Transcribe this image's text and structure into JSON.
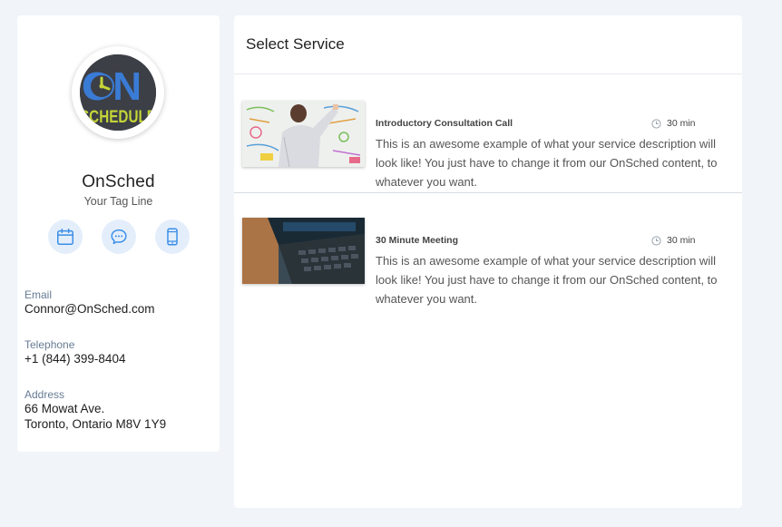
{
  "profile": {
    "logo": {
      "icon": "onschedule-clock-logo",
      "top_text": "ON",
      "bottom_text": "SCHEDULE",
      "top_color": "#3a7bd5",
      "bottom_color": "#c5d636",
      "bg_color": "#3c3f46"
    },
    "name": "OnSched",
    "tagline": "Your Tag Line",
    "contact_icons": [
      "calendar-icon",
      "chat-icon",
      "mobile-icon"
    ],
    "email_label": "Email",
    "email": "Connor@OnSched.com",
    "telephone_label": "Telephone",
    "telephone": "+1 (844) 399-8404",
    "address_label": "Address",
    "address_line1": "66 Mowat Ave.",
    "address_line2": "Toronto, Ontario M8V 1Y9"
  },
  "main": {
    "title": "Select Service",
    "services": [
      {
        "name": "Introductory Consultation Call",
        "duration": "30 min",
        "description": "This is an awesome example of what your service description will look like! You just have to change it from our OnSched content, to whatever you want.",
        "image_icon": "whiteboard-photo"
      },
      {
        "name": "30 Minute Meeting",
        "duration": "30 min",
        "description": "This is an awesome example of what your service description will look like! You just have to change it from our OnSched content, to whatever you want.",
        "image_icon": "laptop-photo"
      }
    ]
  },
  "colors": {
    "page_bg": "#f1f4f8",
    "accent_blue": "#3a8ee6",
    "icon_circle_bg": "#e4eefb",
    "label_color": "#667c94"
  }
}
